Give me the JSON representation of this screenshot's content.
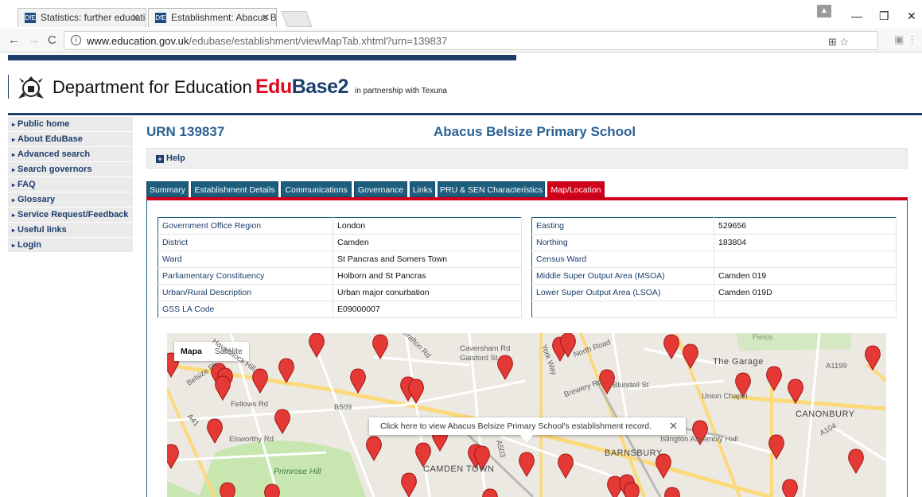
{
  "browser": {
    "tabs": [
      {
        "title": "Statistics: further educati",
        "active": false
      },
      {
        "title": "Establishment: Abacus B",
        "active": true
      }
    ],
    "url_host": "www.education.gov.uk",
    "url_path": "/edubase/establishment/viewMapTab.xhtml?urn=139837"
  },
  "header": {
    "department": "Department for Education",
    "brand_part1": "Edu",
    "brand_part2": "Base2",
    "partner": "in partnership with Texuna"
  },
  "sidebar": {
    "items": [
      {
        "label": "Public home"
      },
      {
        "label": "About EduBase"
      },
      {
        "label": "Advanced search"
      },
      {
        "label": "Search governors"
      },
      {
        "label": "FAQ"
      },
      {
        "label": "Glossary"
      },
      {
        "label": "Service Request/Feedback"
      },
      {
        "label": "Useful links"
      },
      {
        "label": "Login"
      }
    ]
  },
  "page": {
    "urn": "URN 139837",
    "school_name": "Abacus Belsize Primary School",
    "help_label": "Help"
  },
  "tabs": [
    {
      "label": "Summary"
    },
    {
      "label": "Establishment Details"
    },
    {
      "label": "Communications"
    },
    {
      "label": "Governance"
    },
    {
      "label": "Links"
    },
    {
      "label": "PRU & SEN Characteristics"
    },
    {
      "label": "Map/Location"
    }
  ],
  "left_table": [
    {
      "key": "Government Office Region",
      "value": "London"
    },
    {
      "key": "District",
      "value": "Camden"
    },
    {
      "key": "Ward",
      "value": "St Pancras and Somers Town"
    },
    {
      "key": "Parliamentary Constituency",
      "value": "Holborn and St Pancras"
    },
    {
      "key": "Urban/Rural Description",
      "value": "Urban major conurbation"
    },
    {
      "key": "GSS LA Code",
      "value": "E09000007"
    }
  ],
  "right_table": [
    {
      "key": "Easting",
      "value": "529656"
    },
    {
      "key": "Northing",
      "value": "183804"
    },
    {
      "key": "Census Ward",
      "value": ""
    },
    {
      "key": "Middle Super Output Area (MSOA)",
      "value": "Camden 019"
    },
    {
      "key": "Lower Super Output Area (LSOA)",
      "value": "Camden 019D"
    },
    {
      "key": "",
      "value": ""
    }
  ],
  "map": {
    "toggle_selected": "Mapa",
    "toggle_other": "Satélite",
    "info_window": "Click here to view Abacus Belsize Primary School's establishment record.",
    "labels": [
      "Fields",
      "The Garage",
      "Union Chapel",
      "CANONBURY",
      "Islington Assembly Hall",
      "BARNSBURY",
      "CAMDEN TOWN",
      "Primrose Hill",
      "Caversham Rd",
      "Gaisford St",
      "North Road",
      "Haverstock Hill",
      "Fellows Rd",
      "Elsworthy Rd",
      "B509",
      "A1199",
      "A104",
      "A503",
      "A41",
      "Brewery Rd",
      "Blundell St",
      "York Way",
      "Grafton Rd",
      "Belsize Pk"
    ],
    "accent_red": "#d0021b",
    "marker_color": "#e53935"
  }
}
